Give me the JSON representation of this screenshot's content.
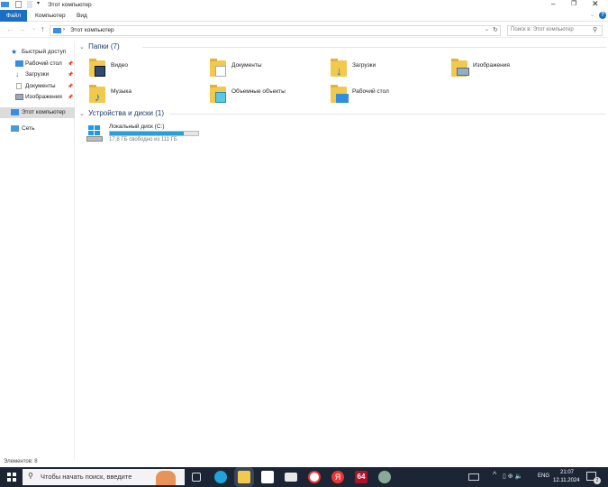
{
  "window": {
    "title": "Этот компьютер"
  },
  "ribbon": {
    "tabs": [
      "Файл",
      "Компьютер",
      "Вид"
    ]
  },
  "address": {
    "path": "Этот компьютер",
    "search_placeholder": "Поиск в: Этот компьютер"
  },
  "nav": {
    "quick_access": "Быстрый доступ",
    "pinned": [
      "Рабочий стол",
      "Загрузки",
      "Документы",
      "Изображения"
    ],
    "this_pc": "Этот компьютер",
    "network": "Сеть"
  },
  "folders": {
    "header": "Папки (7)",
    "items": [
      "Видео",
      "Документы",
      "Загрузки",
      "Изображения",
      "Музыка",
      "Объемные объекты",
      "Рабочий стол"
    ]
  },
  "drives": {
    "header": "Устройства и диски (1)",
    "items": [
      {
        "name": "Локальный диск (C:)",
        "free_text": "17,8 ГБ свободно из 111 ГБ",
        "used_fraction": 0.84
      }
    ]
  },
  "status": {
    "text": "Элементов: 8"
  },
  "taskbar": {
    "search_placeholder": "Чтобы начать поиск, введите",
    "lang": "ENG",
    "time": "21:07",
    "date": "12.11.2024",
    "badge_64": "64",
    "yandex": "Я",
    "notifications": "2"
  },
  "colors": {
    "accent": "#1a6fc4",
    "drive_bar": "#26a0da",
    "taskbar": "#1c2534"
  }
}
